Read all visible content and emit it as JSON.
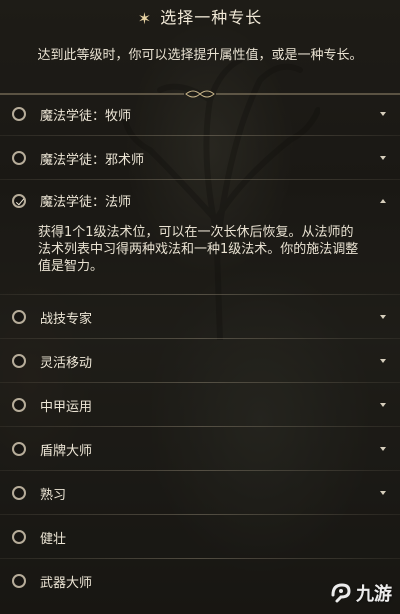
{
  "header": {
    "title": "选择一种专长",
    "icon": "sparkle-icon"
  },
  "intro_text": "达到此等级时，你可以选择提升属性值，或是一种专长。",
  "feats": [
    {
      "label": "魔法学徒：牧师",
      "selected": false,
      "expanded": false
    },
    {
      "label": "魔法学徒：邪术师",
      "selected": false,
      "expanded": false
    },
    {
      "label": "魔法学徒：法师",
      "selected": true,
      "expanded": true,
      "description": "获得1个1级法术位，可以在一次长休后恢复。从法师的法术列表中习得两种戏法和一种1级法术。你的施法调整值是智力。"
    },
    {
      "label": "战技专家",
      "selected": false,
      "expanded": false
    },
    {
      "label": "灵活移动",
      "selected": false,
      "expanded": false
    },
    {
      "label": "中甲运用",
      "selected": false,
      "expanded": false
    },
    {
      "label": "盾牌大师",
      "selected": false,
      "expanded": false
    },
    {
      "label": "熟习",
      "selected": false,
      "expanded": false
    },
    {
      "label": "健壮",
      "selected": false,
      "expanded": false
    },
    {
      "label": "武器大师",
      "selected": false,
      "expanded": false
    }
  ],
  "watermark": {
    "text": "九游",
    "logo": "jiuyou-logo-icon"
  },
  "colors": {
    "text": "#e9e2d2",
    "accent": "#e8d3a3",
    "background": "#1b1915"
  }
}
